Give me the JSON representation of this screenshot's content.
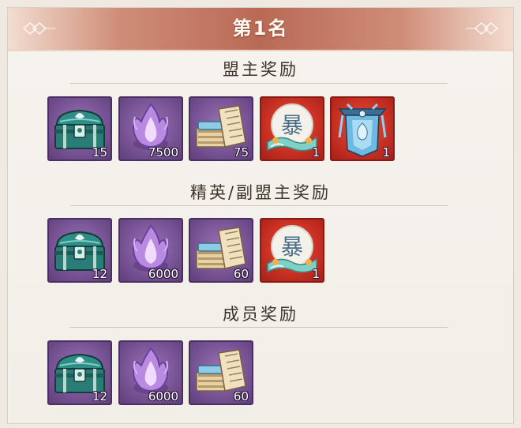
{
  "header": {
    "title": "第1名"
  },
  "sections": [
    {
      "title": "盟主奖励",
      "items": [
        {
          "icon": "treasure-chest-icon",
          "count": "15",
          "frame": "purple"
        },
        {
          "icon": "purple-flame-icon",
          "count": "7500",
          "frame": "purple"
        },
        {
          "icon": "scroll-book-icon",
          "count": "75",
          "frame": "purple"
        },
        {
          "icon": "calligraphy-orb-icon",
          "glyph": "暴",
          "count": "1",
          "frame": "red"
        },
        {
          "icon": "ornate-banner-icon",
          "count": "1",
          "frame": "red"
        }
      ]
    },
    {
      "title": "精英/副盟主奖励",
      "items": [
        {
          "icon": "treasure-chest-icon",
          "count": "12",
          "frame": "purple"
        },
        {
          "icon": "purple-flame-icon",
          "count": "6000",
          "frame": "purple"
        },
        {
          "icon": "scroll-book-icon",
          "count": "60",
          "frame": "purple"
        },
        {
          "icon": "calligraphy-orb-icon",
          "glyph": "暴",
          "count": "1",
          "frame": "red"
        }
      ]
    },
    {
      "title": "成员奖励",
      "items": [
        {
          "icon": "treasure-chest-icon",
          "count": "12",
          "frame": "purple"
        },
        {
          "icon": "purple-flame-icon",
          "count": "6000",
          "frame": "purple"
        },
        {
          "icon": "scroll-book-icon",
          "count": "60",
          "frame": "purple"
        }
      ]
    }
  ]
}
